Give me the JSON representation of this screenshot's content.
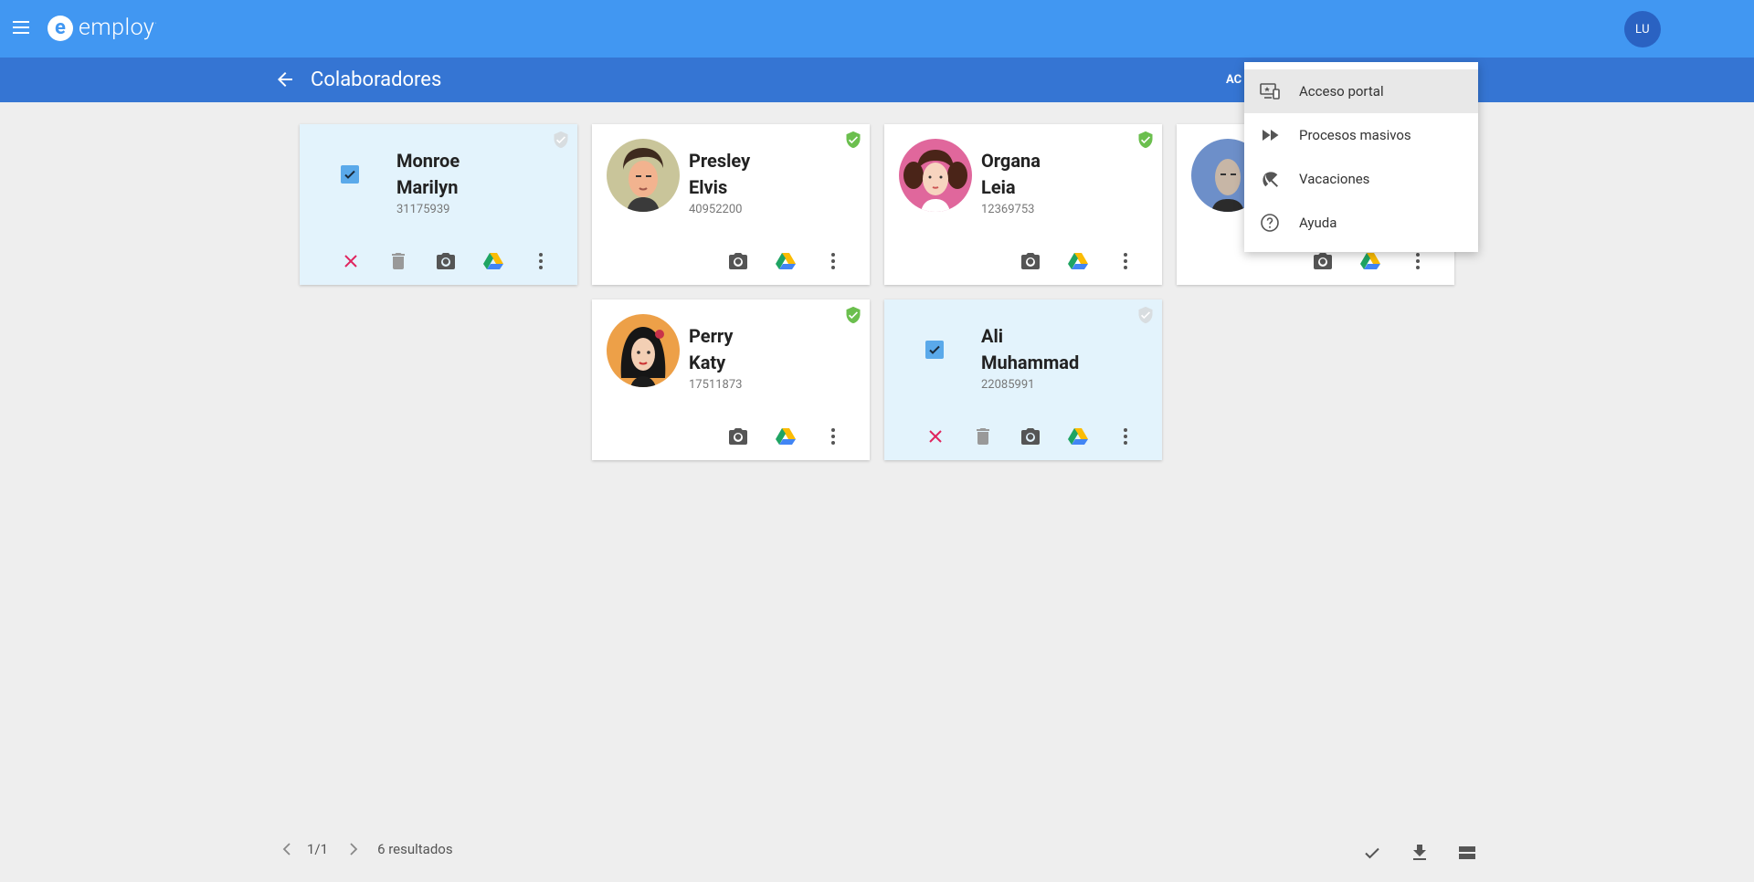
{
  "header": {
    "brand": "employ",
    "brand_mark": "e",
    "avatar_initials": "LU",
    "colors": {
      "topbar": "#4197f2",
      "subbar": "#3575d3",
      "avatar": "#2a62c2"
    }
  },
  "subheader": {
    "title": "Colaboradores",
    "partial_action_label": "AC"
  },
  "cards": [
    {
      "first": "Monroe",
      "last": "Marilyn",
      "id": "31175939",
      "selected": true,
      "verified": false
    },
    {
      "first": "Presley",
      "last": "Elvis",
      "id": "40952200",
      "selected": false,
      "verified": true
    },
    {
      "first": "Organa",
      "last": "Leia",
      "id": "12369753",
      "selected": false,
      "verified": true
    },
    {
      "first": "",
      "last": "",
      "id": "",
      "selected": false,
      "verified": false
    },
    {
      "first": "Perry",
      "last": "Katy",
      "id": "17511873",
      "selected": false,
      "verified": true
    },
    {
      "first": "Ali",
      "last": "Muhammad",
      "id": "22085991",
      "selected": true,
      "verified": false
    }
  ],
  "menu": {
    "items": [
      {
        "label": "Acceso portal",
        "icon": "portal-icon"
      },
      {
        "label": "Procesos masivos",
        "icon": "fast-forward-icon"
      },
      {
        "label": "Vacaciones",
        "icon": "beach-umbrella-icon"
      },
      {
        "label": "Ayuda",
        "icon": "help-icon"
      }
    ]
  },
  "footer": {
    "page": "1/1",
    "results": "6 resultados"
  }
}
